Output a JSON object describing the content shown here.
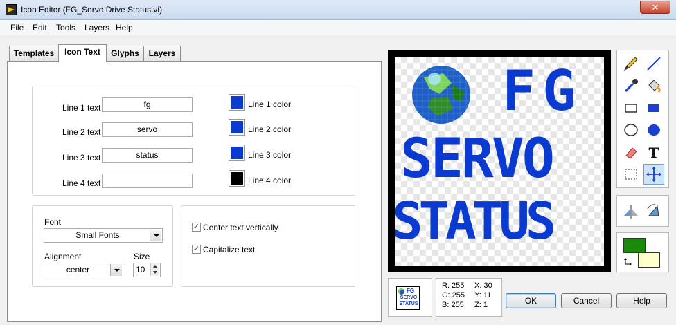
{
  "window": {
    "title": "Icon Editor (FG_Servo Drive Status.vi)",
    "close_label": "✕"
  },
  "menu": [
    "File",
    "Edit",
    "Tools",
    "Layers",
    "Help"
  ],
  "tabs": [
    "Templates",
    "Icon Text",
    "Glyphs",
    "Layers"
  ],
  "active_tab": "Icon Text",
  "lines": [
    {
      "label": "Line 1 text",
      "value": "fg",
      "color_label": "Line 1 color",
      "color": "#0a3ad0"
    },
    {
      "label": "Line 2 text",
      "value": "servo",
      "color_label": "Line 2 color",
      "color": "#0a3ad0"
    },
    {
      "label": "Line 3 text",
      "value": "status",
      "color_label": "Line 3 color",
      "color": "#0a3ad0"
    },
    {
      "label": "Line 4 text",
      "value": "",
      "color_label": "Line 4 color",
      "color": "#000000"
    }
  ],
  "font": {
    "label": "Font",
    "value": "Small Fonts"
  },
  "alignment": {
    "label": "Alignment",
    "value": "center"
  },
  "size": {
    "label": "Size",
    "value": "10"
  },
  "options": {
    "center_vertically": {
      "label": "Center text vertically",
      "checked": true
    },
    "capitalize": {
      "label": "Capitalize text",
      "checked": true
    }
  },
  "canvas": {
    "lines": [
      "FG",
      "SERVO",
      "STATUS"
    ]
  },
  "preview": {
    "lines": [
      "FG",
      "SERVO",
      "STATUS"
    ]
  },
  "pixel_info": {
    "r": "R: 255",
    "g": "G: 255",
    "b": "B: 255",
    "x": "X: 30",
    "y": "Y: 11",
    "z": "Z: 1"
  },
  "colors": {
    "foreground": "#1a8a0a",
    "background": "#ffffcc"
  },
  "buttons": {
    "ok": "OK",
    "cancel": "Cancel",
    "help": "Help"
  }
}
